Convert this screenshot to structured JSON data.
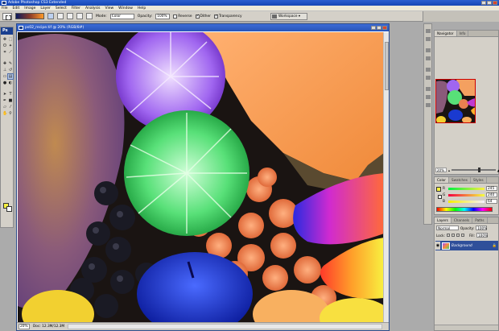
{
  "app": {
    "title": "Adobe Photoshop CS3 Extended"
  },
  "menu": [
    "File",
    "Edit",
    "Image",
    "Layer",
    "Select",
    "Filter",
    "Analysis",
    "View",
    "Window",
    "Help"
  ],
  "options_bar": {
    "mode_label": "Mode:",
    "mode_value": "Color",
    "opacity_label": "Opacity:",
    "opacity_value": "100%",
    "reverse_label": "Reverse",
    "dither_label": "Dither",
    "transparency_label": "Transparency",
    "workspace_label": "Workspace ▾"
  },
  "toolbox": {
    "header": "Ps",
    "fg_color": "#f5f040",
    "bg_color": "#ffffff"
  },
  "document": {
    "title": "ps02_recipe.tif @ 20% (RGB/8#)",
    "zoom": "20%",
    "status": "Doc: 12.3M/12.3M"
  },
  "navigator_panel": {
    "tabs": [
      "Navigator",
      "Info"
    ],
    "zoom": "20%"
  },
  "color_panel": {
    "tabs": [
      "Color",
      "Swatches",
      "Styles"
    ],
    "channels": [
      {
        "label": "R",
        "value": "245"
      },
      {
        "label": "G",
        "value": "240"
      },
      {
        "label": "B",
        "value": "64"
      }
    ]
  },
  "layers_panel": {
    "tabs": [
      "Layers",
      "Channels",
      "Paths"
    ],
    "blend_mode": "Normal",
    "opacity_label": "Opacity:",
    "opacity": "100%",
    "lock_label": "Lock:",
    "fill_label": "Fill:",
    "fill": "100%",
    "layer_name": "Background"
  },
  "colors": {
    "accent": "#2754b8",
    "panel": "#d4d0c8",
    "selection": "#2f4f9a"
  }
}
